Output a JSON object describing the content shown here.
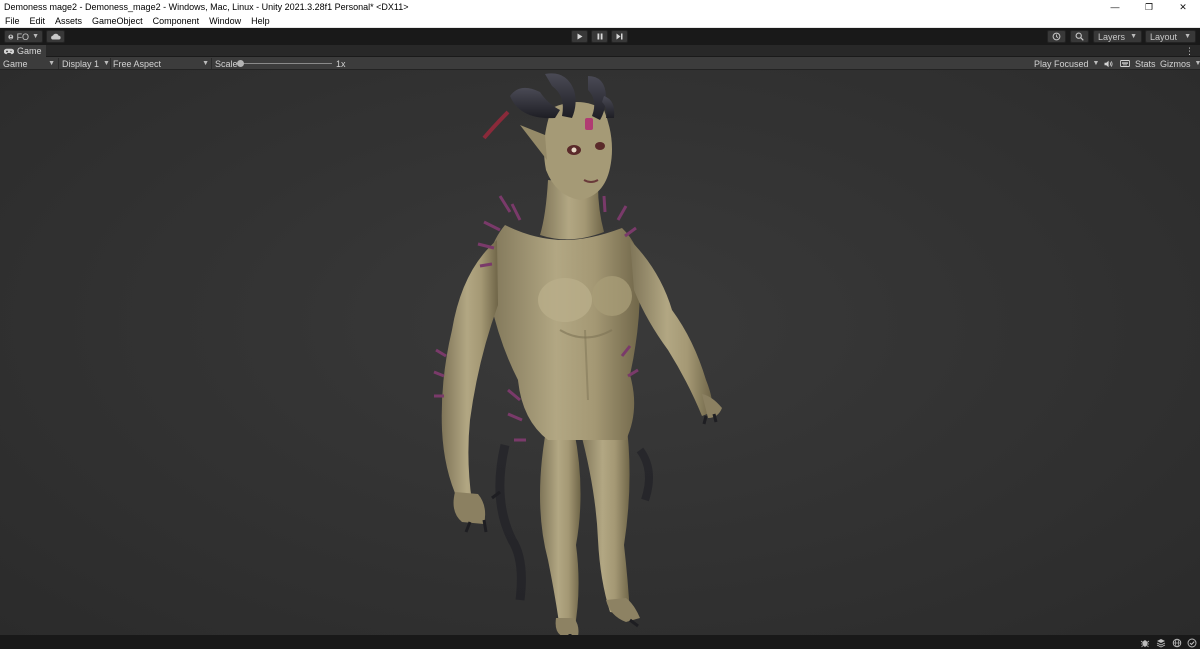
{
  "window": {
    "title": "Demoness mage2 - Demoness_mage2 - Windows, Mac, Linux - Unity 2021.3.28f1 Personal* <DX11>",
    "controls": {
      "minimize": "—",
      "restore": "❐",
      "close": "✕"
    }
  },
  "menu": [
    "File",
    "Edit",
    "Assets",
    "GameObject",
    "Component",
    "Window",
    "Help"
  ],
  "toolbar": {
    "account_label": "FO",
    "layers_label": "Layers",
    "layout_label": "Layout",
    "icons": [
      "account-icon",
      "cloud-icon",
      "play-icon",
      "pause-icon",
      "step-icon",
      "history-icon",
      "search-icon"
    ]
  },
  "game_tab": {
    "label": "Game",
    "menu_glyph": "⋮"
  },
  "game_bar": {
    "mode": "Game",
    "display": "Display 1",
    "aspect": "Free Aspect",
    "scale_label": "Scale",
    "scale_value": "1x",
    "scale_fraction": 0.0,
    "play_mode": "Play Focused",
    "stats_label": "Stats",
    "gizmos_label": "Gizmos"
  },
  "colors": {
    "title_bg": "#ffffff",
    "toolbar_bg": "#191919",
    "panel_bg": "#3c3c3c",
    "viewport_bg": "#333333",
    "skin": "#a79a78",
    "horn": "#2a2a30",
    "spikes": "#7a3a6a"
  },
  "status_icons": [
    "bug-icon",
    "layers-icon",
    "globe-icon",
    "check-icon"
  ]
}
